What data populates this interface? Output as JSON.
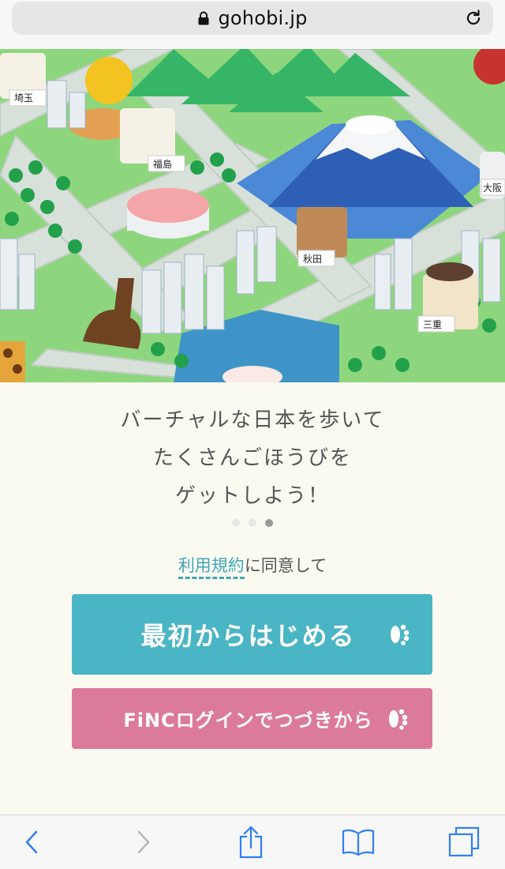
{
  "browser": {
    "url": "gohobi.jp"
  },
  "hero": {
    "badges": [
      "埼玉",
      "福島",
      "秋田",
      "大阪",
      "三重"
    ]
  },
  "tagline": {
    "line1": "バーチャルな日本を歩いて",
    "line2": "たくさんごほうびを",
    "line3": "ゲットしよう！"
  },
  "carousel": {
    "page_count": 3,
    "active_index": 2
  },
  "agree": {
    "terms_link": "利用規約",
    "suffix": "に同意して"
  },
  "buttons": {
    "start": "最初からはじめる",
    "login": "FiNCログインでつづきから"
  },
  "colors": {
    "start_button": "#4ab5c4",
    "login_button": "#dc7a9b",
    "link": "#3fa6ba",
    "safari_blue": "#2f7ff6"
  },
  "toolbar": {
    "icons": [
      "back-icon",
      "forward-icon",
      "share-icon",
      "bookmarks-icon",
      "tabs-icon"
    ]
  }
}
